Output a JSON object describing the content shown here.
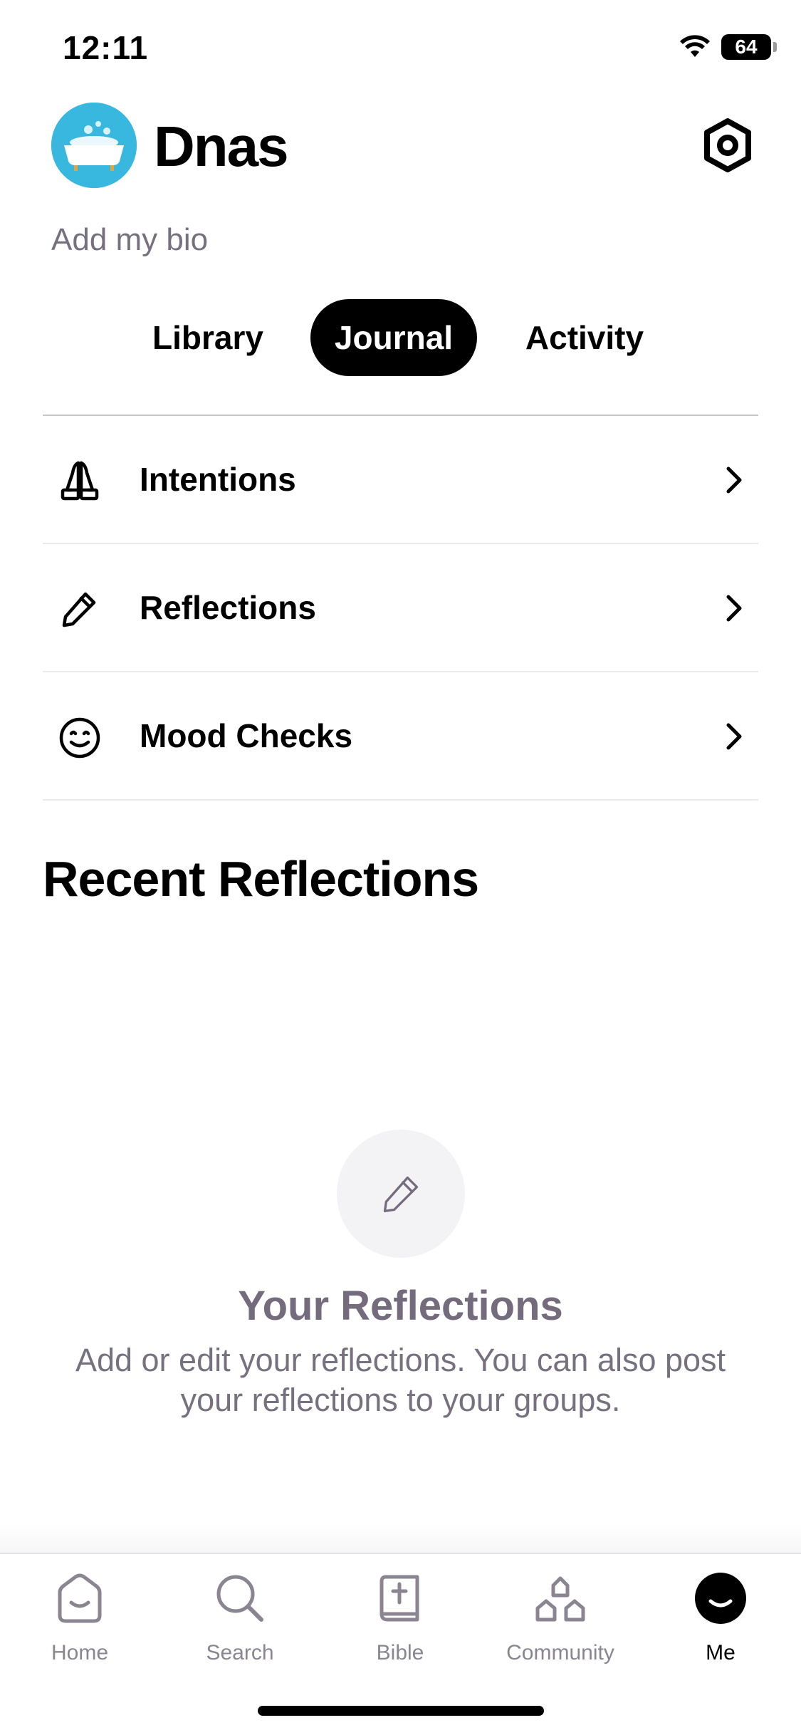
{
  "status_bar": {
    "time": "12:11",
    "battery": "64"
  },
  "profile": {
    "name": "Dnas",
    "bio_placeholder": "Add my bio"
  },
  "tabs": [
    {
      "label": "Library",
      "active": false
    },
    {
      "label": "Journal",
      "active": true
    },
    {
      "label": "Activity",
      "active": false
    }
  ],
  "journal_items": [
    {
      "label": "Intentions",
      "icon": "praying-hands-icon"
    },
    {
      "label": "Reflections",
      "icon": "pencil-icon"
    },
    {
      "label": "Mood Checks",
      "icon": "smiley-icon"
    }
  ],
  "recent": {
    "title": "Recent Reflections",
    "empty_title": "Your Reflections",
    "empty_description": "Add or edit your reflections. You can also post your reflections to your groups."
  },
  "bottom_nav": [
    {
      "label": "Home",
      "icon": "home-icon",
      "active": false
    },
    {
      "label": "Search",
      "icon": "search-icon",
      "active": false
    },
    {
      "label": "Bible",
      "icon": "bible-icon",
      "active": false
    },
    {
      "label": "Community",
      "icon": "community-icon",
      "active": false
    },
    {
      "label": "Me",
      "icon": "me-icon",
      "active": true
    }
  ],
  "colors": {
    "accent": "#000000",
    "muted_text": "#77717f",
    "avatar_bg": "#39b8df"
  }
}
